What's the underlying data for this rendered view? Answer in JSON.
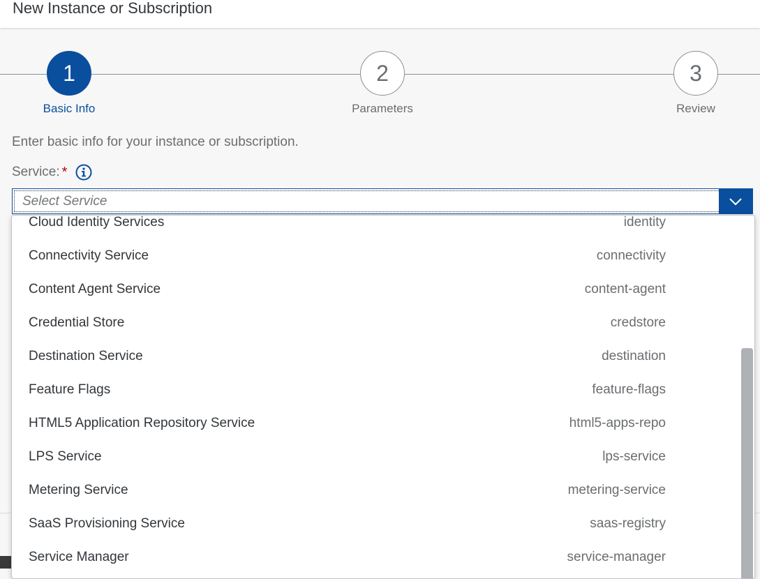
{
  "dialog": {
    "title": "New Instance or Subscription"
  },
  "wizard": {
    "steps": [
      {
        "number": "1",
        "label": "Basic Info",
        "active": true
      },
      {
        "number": "2",
        "label": "Parameters",
        "active": false
      },
      {
        "number": "3",
        "label": "Review",
        "active": false
      }
    ]
  },
  "form": {
    "intro": "Enter basic info for your instance or subscription.",
    "service_label": "Service:",
    "required_marker": "*",
    "select_placeholder": "Select Service"
  },
  "dropdown": {
    "items": [
      {
        "name": "Cloud Identity Services",
        "id": "identity"
      },
      {
        "name": "Connectivity Service",
        "id": "connectivity"
      },
      {
        "name": "Content Agent Service",
        "id": "content-agent"
      },
      {
        "name": "Credential Store",
        "id": "credstore"
      },
      {
        "name": "Destination Service",
        "id": "destination"
      },
      {
        "name": "Feature Flags",
        "id": "feature-flags"
      },
      {
        "name": "HTML5 Application Repository Service",
        "id": "html5-apps-repo"
      },
      {
        "name": "LPS Service",
        "id": "lps-service"
      },
      {
        "name": "Metering Service",
        "id": "metering-service"
      },
      {
        "name": "SaaS Provisioning Service",
        "id": "saas-registry"
      },
      {
        "name": "Service Manager",
        "id": "service-manager"
      }
    ]
  },
  "colors": {
    "accent": "#0a4f9e",
    "required": "#bb0000",
    "text": "#32363a",
    "muted": "#6a6d70"
  },
  "icons": {
    "info": "info-icon",
    "dropdown": "chevron-down-icon"
  }
}
